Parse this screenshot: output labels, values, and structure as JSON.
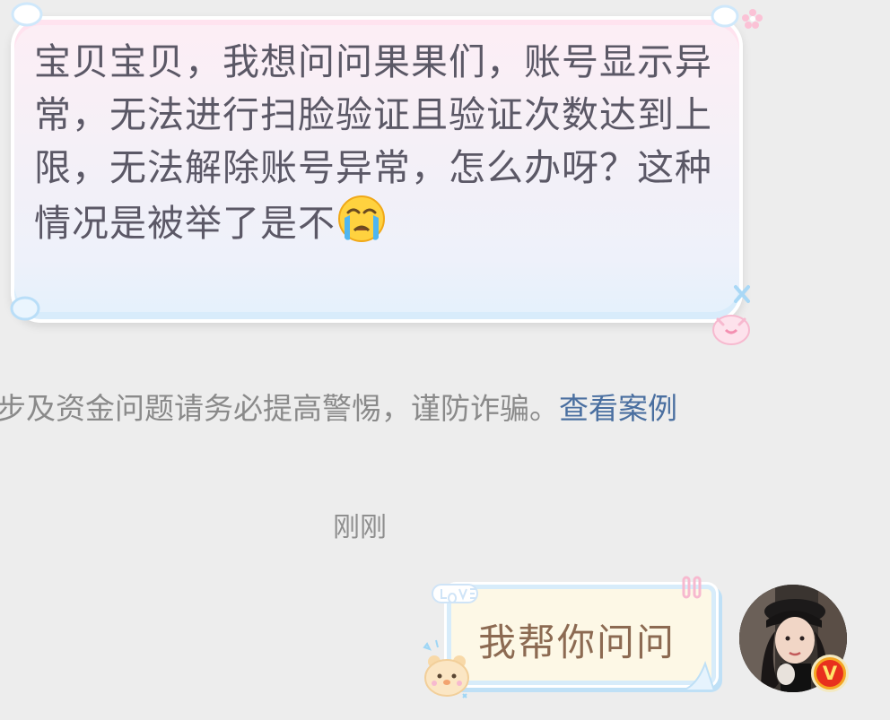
{
  "incoming_message": {
    "text": "宝贝宝贝，我想问问果果们，账号显示异常，无法进行扫脸验证且验证次数达到上限，无法解除账号异常，怎么办呀？这种情况是被举了是不",
    "emoji": "crying-face-icon"
  },
  "notice": {
    "text": "步及资金问题请务必提高警惕，谨防诈骗。",
    "link_label": "查看案例"
  },
  "timestamp": "刚刚",
  "outgoing_message": {
    "text": "我帮你问问"
  },
  "avatar": {
    "badge_letter": "V"
  },
  "colors": {
    "background": "#ededed",
    "incoming_text": "#5b5866",
    "notice_text": "#8a8a8a",
    "link": "#4a6fa0",
    "outgoing_text": "#8c6a52",
    "badge": "#e8301d"
  }
}
